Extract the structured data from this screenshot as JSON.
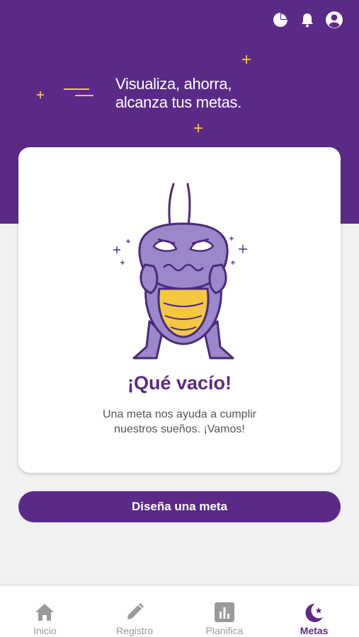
{
  "header": {
    "tagline_line1": "Visualiza, ahorra,",
    "tagline_line2": "alcanza tus metas.",
    "icons": [
      "pie-chart-icon",
      "bell-icon",
      "account-icon"
    ]
  },
  "empty_state": {
    "title": "¡Qué vacío!",
    "text_line1": "Una meta nos ayuda a cumplir",
    "text_line2": "nuestros sueños. ¡Vamos!"
  },
  "cta": {
    "label": "Diseña una meta"
  },
  "nav": {
    "items": [
      {
        "label": "Inicio",
        "icon": "home-icon"
      },
      {
        "label": "Registro",
        "icon": "pencil-icon"
      },
      {
        "label": "Planifica",
        "icon": "bar-chart-icon"
      },
      {
        "label": "Metas",
        "icon": "moon-star-icon",
        "active": true
      }
    ]
  },
  "colors": {
    "primary": "#5b2a86",
    "accent": "#f5c842",
    "background": "#f1f0f2",
    "mascot": "#9b87c9"
  }
}
